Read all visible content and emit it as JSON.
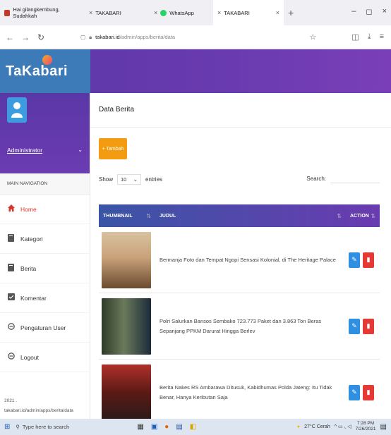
{
  "browser": {
    "tabs": [
      {
        "label": "Hai gilangkembung, Sudahkah ",
        "color": "#c0392b",
        "active": false
      },
      {
        "label": "TAKABARI",
        "color": "#cccccc",
        "active": false
      },
      {
        "label": "WhatsApp",
        "color": "#25d366",
        "active": false
      },
      {
        "label": "TAKABARI",
        "color": "#cccccc",
        "active": true
      }
    ],
    "close_glyph": "×",
    "newtab_glyph": "+",
    "url_host": "takabari.id",
    "url_path": "/admin/apps/berita/data",
    "window_controls": [
      "–",
      "◻",
      "×"
    ]
  },
  "app": {
    "logo": "TaKabari",
    "accent": "#6a3bb0"
  },
  "sidebar": {
    "user_name": "Administrator",
    "nav_header": "MAIN NAVIGATION",
    "items": [
      {
        "label": "Home",
        "icon": "home-icon",
        "glyph": "⌂",
        "active": true
      },
      {
        "label": "Kategori",
        "icon": "book-icon",
        "glyph": "▮",
        "active": false
      },
      {
        "label": "Berita",
        "icon": "news-icon",
        "glyph": "▮",
        "active": false
      },
      {
        "label": "Komentar",
        "icon": "comment-icon",
        "glyph": "▣",
        "active": false
      },
      {
        "label": "Pengaturan User",
        "icon": "user-settings-icon",
        "glyph": "◉",
        "active": false
      },
      {
        "label": "Logout",
        "icon": "logout-icon",
        "glyph": "◉",
        "active": false
      }
    ],
    "footer_year": "2021 .",
    "footer_url": "takabari.id/admin/apps/berita/data"
  },
  "main": {
    "title": "Data Berita",
    "add_label": "+ Tambah",
    "show_label": "Show",
    "entries_value": "10",
    "entries_label": "entries",
    "search_label": "Search:",
    "columns": {
      "thumb": "THUMBNAIL",
      "judul": "JUDUL",
      "action": "ACTION"
    },
    "rows": [
      {
        "judul": "Bermanja Foto dan Tempat Ngopi Sensasi Kolonial, di The Heritage Palace",
        "thumb_colors": [
          "#c9a27a",
          "#6b4a2e",
          "#d8c2a0"
        ]
      },
      {
        "judul": "Polri Salurkan Bansos Sembako 723.773 Paket dan 3.863 Ton Beras Sepanjang PPKM Darurat Hingga Berlev",
        "thumb_colors": [
          "#2e3b2a",
          "#6a7a5a",
          "#1b2a3a"
        ]
      },
      {
        "judul": "Berita Nakes RS Ambarawa Ditusuk, Kabidhumas Polda Jateng: Itu Tidak Benar, Hanya Keributan Saja",
        "thumb_colors": [
          "#5a1a14",
          "#b0302a",
          "#2a1a1a"
        ]
      }
    ]
  },
  "taskbar": {
    "search_placeholder": "Type here to search",
    "weather": "27°C Cerah",
    "time": "7:28 PM",
    "date": "7/26/2021"
  }
}
